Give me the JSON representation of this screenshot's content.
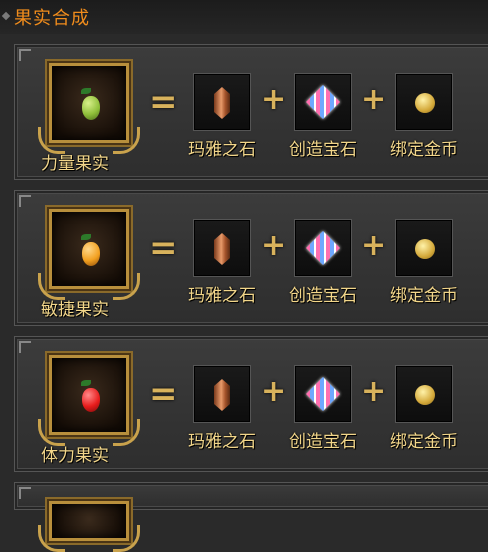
{
  "header": {
    "title": "果实合成"
  },
  "operators": {
    "equals": "=",
    "plus": "+"
  },
  "items": [
    "玛雅之石",
    "创造宝石",
    "绑定金币"
  ],
  "recipes": [
    {
      "fruit": "力量果实",
      "fruit_color": "#8fbf3a"
    },
    {
      "fruit": "敏捷果实",
      "fruit_color": "#f2a020"
    },
    {
      "fruit": "体力果实",
      "fruit_color": "#e81c1c"
    }
  ],
  "icons": {
    "fruit": "fruit-icon",
    "item1": "mayan-stone-icon",
    "item2": "creation-gem-icon",
    "item3": "gold-coin-icon"
  },
  "colors": {
    "title": "#f08c1c",
    "label": "#f2d68a",
    "gold": "#d8b25c"
  }
}
